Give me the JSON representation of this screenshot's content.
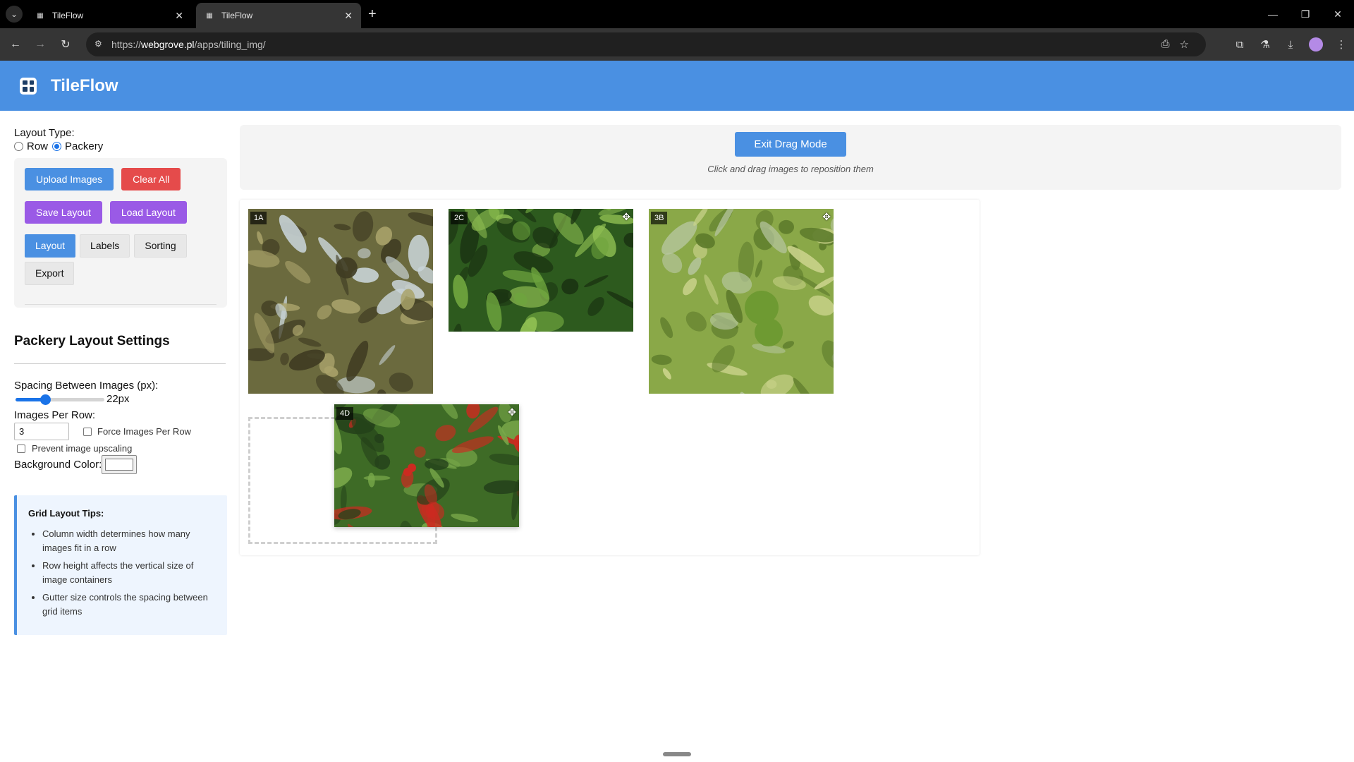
{
  "browser": {
    "tabs": [
      {
        "title": "TileFlow",
        "active": false
      },
      {
        "title": "TileFlow",
        "active": true
      }
    ],
    "url_scheme": "https://",
    "url_domain": "webgrove.pl",
    "url_path": "/apps/tiling_img/"
  },
  "app": {
    "title": "TileFlow",
    "brand_color": "#4a90e2"
  },
  "sidebar": {
    "layout_type_label": "Layout Type:",
    "layout_options": [
      {
        "label": "Row",
        "selected": false
      },
      {
        "label": "Packery",
        "selected": true
      }
    ],
    "buttons": {
      "upload": "Upload Images",
      "clear": "Clear All",
      "save": "Save Layout",
      "load": "Load Layout"
    },
    "tabs": [
      {
        "label": "Layout",
        "active": true
      },
      {
        "label": "Labels",
        "active": false
      },
      {
        "label": "Sorting",
        "active": false
      },
      {
        "label": "Export",
        "active": false
      }
    ],
    "settings_title": "Packery Layout Settings",
    "spacing_label": "Spacing Between Images (px):",
    "spacing_value": 22,
    "spacing_display": "22px",
    "spacing_fraction": 0.33,
    "images_per_row_label": "Images Per Row:",
    "images_per_row_value": "3",
    "force_images_label": "Force Images Per Row",
    "force_images_checked": false,
    "prevent_upscaling_label": "Prevent image upscaling",
    "prevent_upscaling_checked": false,
    "bg_color_label": "Background Color:",
    "bg_color_value": "#ffffff",
    "tips": {
      "title": "Grid Layout Tips:",
      "items": [
        "Column width determines how many images fit in a row",
        "Row height affects the vertical size of image containers",
        "Gutter size controls the spacing between grid items"
      ]
    }
  },
  "main": {
    "exit_drag_label": "Exit Drag Mode",
    "hint": "Click and drag images to reposition them",
    "tiles": [
      {
        "label": "1A",
        "subject": "palm tree with fruit clusters",
        "palette": [
          "#6b6a3e",
          "#a9a26a",
          "#3f3b22",
          "#c9d4d8"
        ]
      },
      {
        "label": "2C",
        "subject": "green plant leaves",
        "palette": [
          "#2d5a1e",
          "#6ea43e",
          "#1b3412",
          "#8fbf52"
        ]
      },
      {
        "label": "3B",
        "subject": "green fruit on branch",
        "palette": [
          "#8aa848",
          "#5e7c2c",
          "#c9d28a",
          "#b7c6a0"
        ]
      },
      {
        "label": "4D",
        "subject": "shrub with red berries",
        "palette": [
          "#3e6b26",
          "#79a84a",
          "#24411a",
          "#cc2a20"
        ]
      }
    ]
  }
}
